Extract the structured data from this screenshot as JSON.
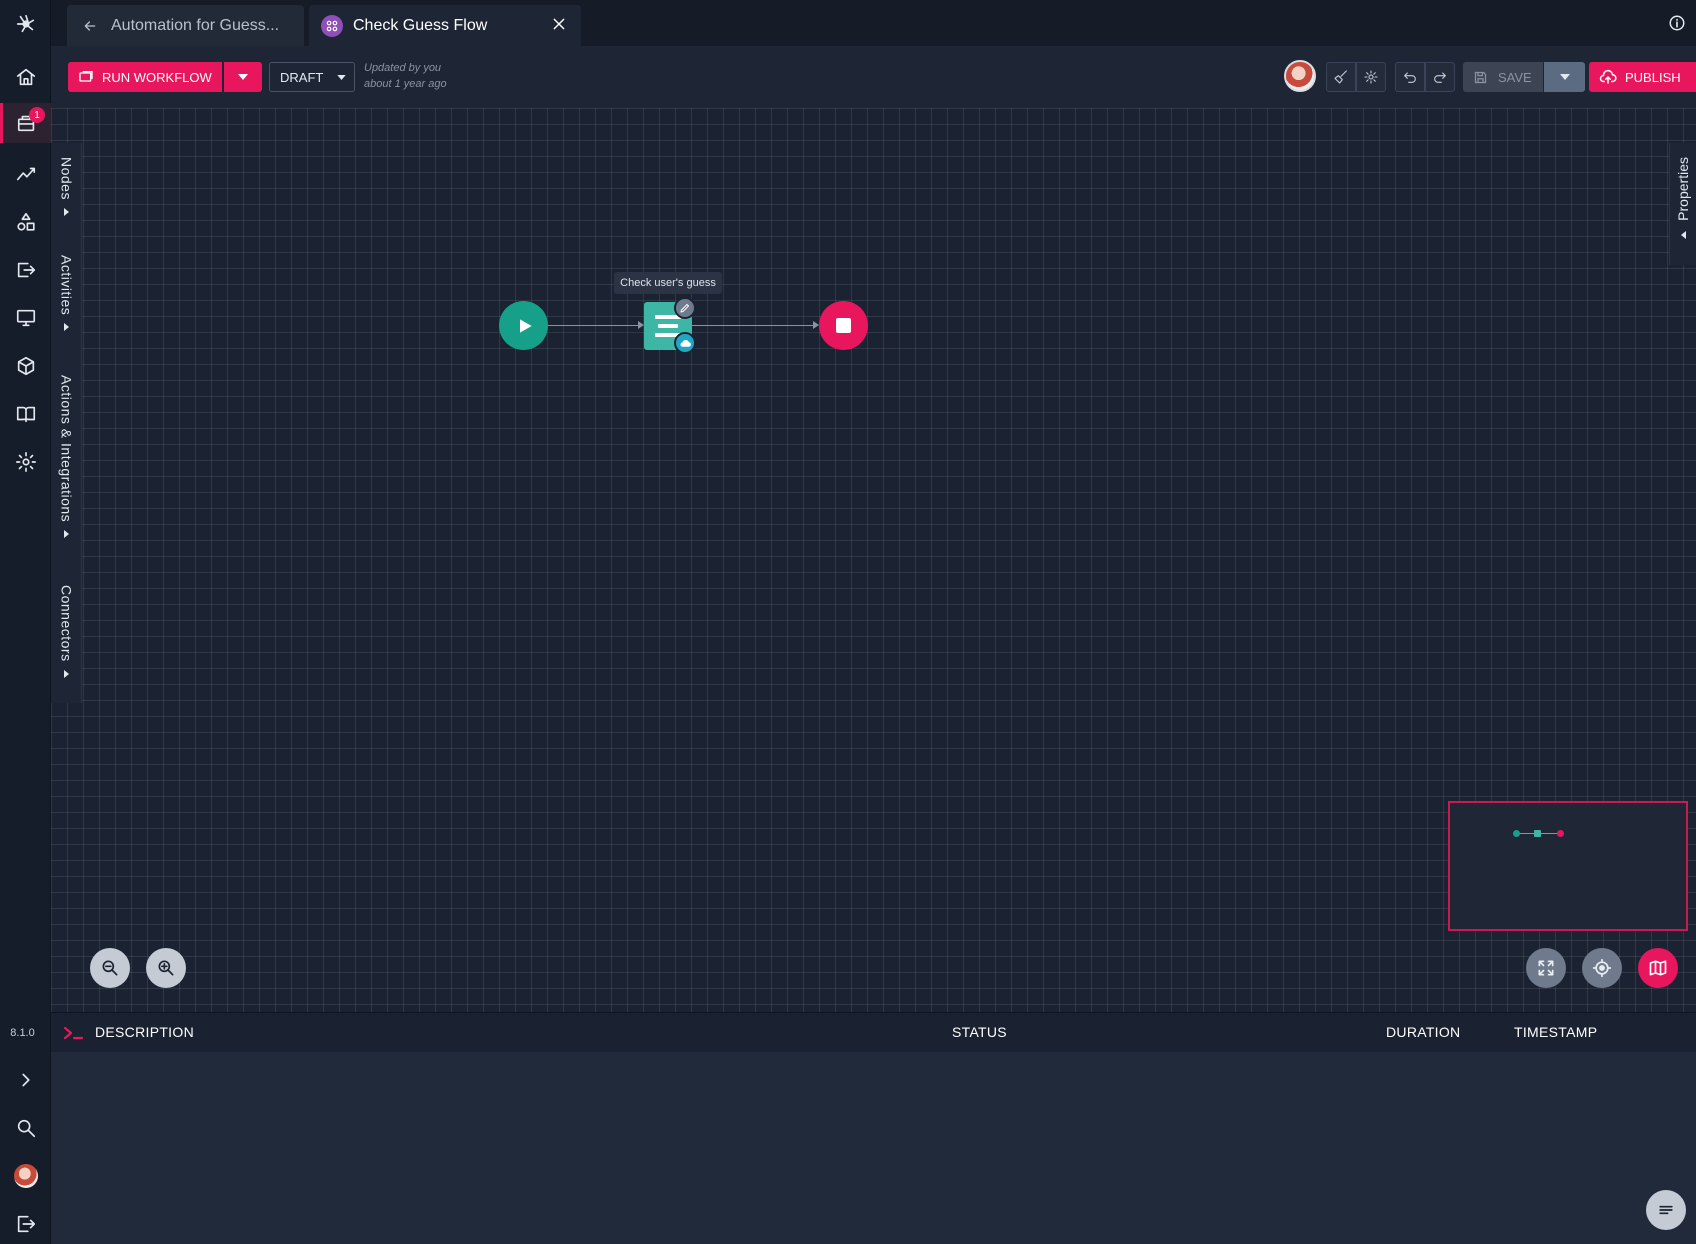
{
  "nav": {
    "notification_count": "1",
    "version": "8.1.0"
  },
  "tabs": {
    "back_tab_label": "Automation for Guess...",
    "active_tab_label": "Check Guess Flow"
  },
  "toolbar": {
    "run_label": "RUN WORKFLOW",
    "draft_label": "DRAFT",
    "updated_line1": "Updated by you",
    "updated_line2": "about 1 year ago",
    "save_label": "SAVE",
    "publish_label": "PUBLISH"
  },
  "side_panels": {
    "nodes": "Nodes",
    "activities": "Activities",
    "actions": "Actions & Integrations",
    "connectors": "Connectors",
    "properties": "Properties"
  },
  "flow": {
    "task_tooltip": "Check user's guess"
  },
  "log": {
    "col_description": "DESCRIPTION",
    "col_status": "STATUS",
    "col_duration": "DURATION",
    "col_timestamp": "TIMESTAMP"
  },
  "colors": {
    "accent": "#e8175d",
    "start_node": "#16a08a",
    "task_node": "#3db6a6",
    "background": "#1b2333"
  },
  "icons": {
    "nav": [
      "logo-icon",
      "home-icon",
      "automations-icon",
      "analytics-icon",
      "shapes-icon",
      "export-icon",
      "monitor-icon",
      "package-icon",
      "book-icon",
      "settings-icon",
      "expand-icon",
      "search-icon",
      "avatar",
      "logout-icon"
    ]
  }
}
